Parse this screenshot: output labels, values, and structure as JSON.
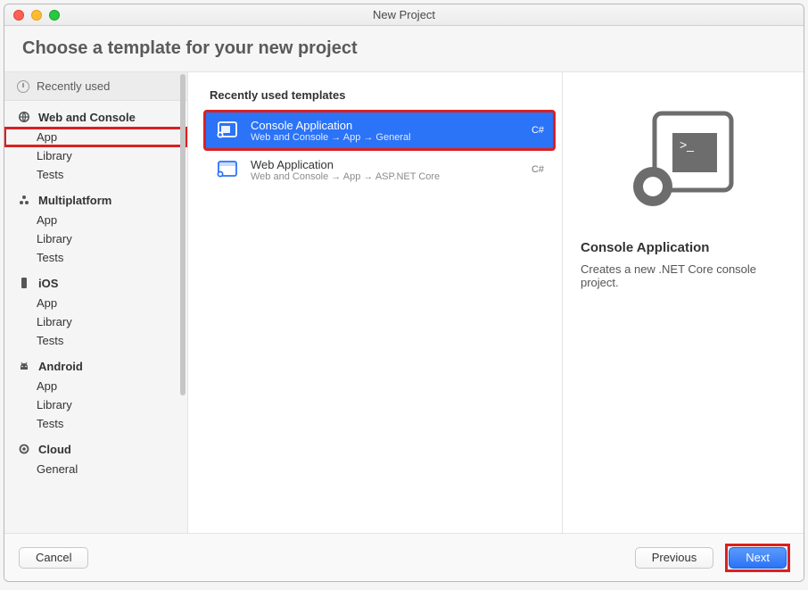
{
  "window": {
    "title": "New Project"
  },
  "header": {
    "title": "Choose a template for your new project"
  },
  "sidebar": {
    "recent": "Recently used",
    "categories": [
      {
        "label": "Web and Console",
        "items": [
          "App",
          "Library",
          "Tests"
        ]
      },
      {
        "label": "Multiplatform",
        "items": [
          "App",
          "Library",
          "Tests"
        ]
      },
      {
        "label": "iOS",
        "items": [
          "App",
          "Library",
          "Tests"
        ]
      },
      {
        "label": "Android",
        "items": [
          "App",
          "Library",
          "Tests"
        ]
      },
      {
        "label": "Cloud",
        "items": [
          "General"
        ]
      }
    ]
  },
  "templates": {
    "heading": "Recently used templates",
    "items": [
      {
        "title": "Console Application",
        "path": "Web and Console → App → General",
        "badge": "C#"
      },
      {
        "title": "Web Application",
        "path": "Web and Console → App → ASP.NET Core",
        "badge": "C#"
      }
    ]
  },
  "details": {
    "title": "Console Application",
    "description": "Creates a new .NET Core console project."
  },
  "footer": {
    "cancel": "Cancel",
    "previous": "Previous",
    "next": "Next"
  }
}
